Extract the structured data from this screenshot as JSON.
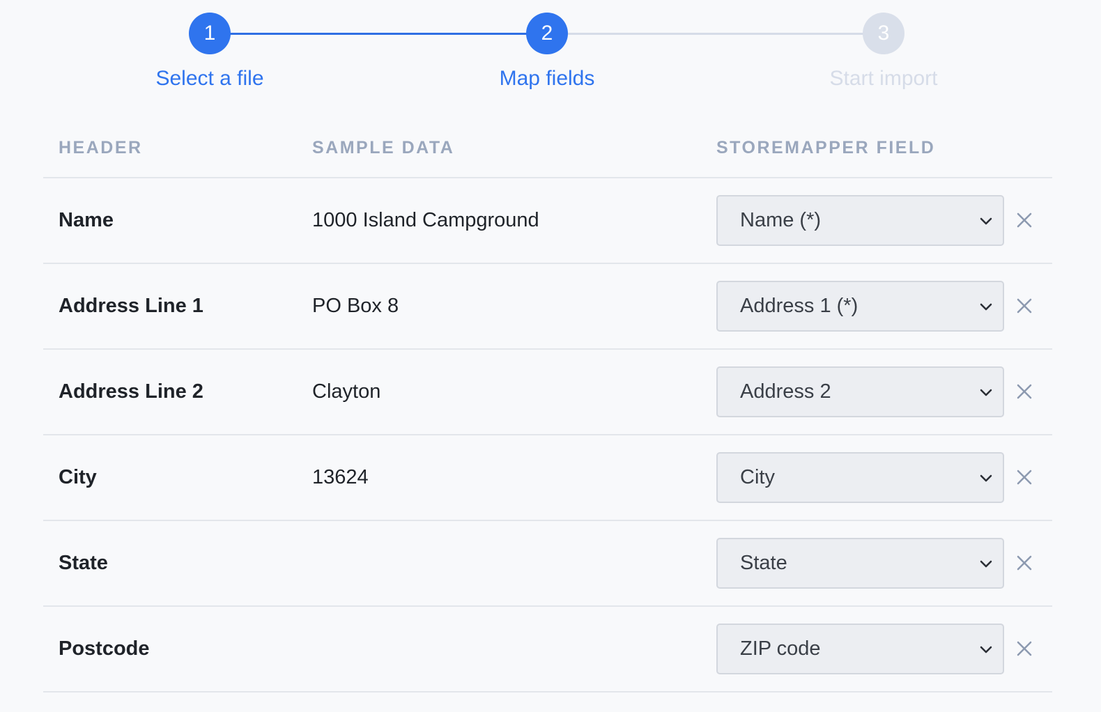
{
  "stepper": {
    "steps": [
      {
        "number": "1",
        "label": "Select a file",
        "state": "completed"
      },
      {
        "number": "2",
        "label": "Map fields",
        "state": "current"
      },
      {
        "number": "3",
        "label": "Start import",
        "state": "upcoming"
      }
    ]
  },
  "table": {
    "columns": [
      "HEADER",
      "SAMPLE DATA",
      "STOREMAPPER FIELD"
    ],
    "rows": [
      {
        "header": "Name",
        "sample": "1000 Island Campground",
        "field": "Name (*)"
      },
      {
        "header": "Address Line 1",
        "sample": "PO Box 8",
        "field": "Address 1 (*)"
      },
      {
        "header": "Address Line 2",
        "sample": "Clayton",
        "field": "Address 2"
      },
      {
        "header": "City",
        "sample": "13624",
        "field": "City"
      },
      {
        "header": "State",
        "sample": "",
        "field": "State"
      },
      {
        "header": "Postcode",
        "sample": "",
        "field": "ZIP code"
      }
    ]
  },
  "icons": {
    "select_arrow": "chevron-down-icon",
    "remove": "close-icon"
  },
  "colors": {
    "accent": "#2f74ee",
    "inactive_step": "#d9dfea",
    "column_header": "#9aa7bd"
  }
}
